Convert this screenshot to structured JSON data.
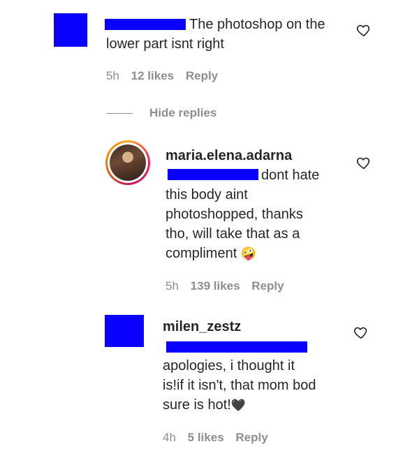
{
  "comment1": {
    "text_line1": "The photoshop on the",
    "text_line2": "lower part isnt right",
    "time": "5h",
    "likes": "12 likes",
    "reply": "Reply",
    "hide_replies": "Hide replies"
  },
  "reply1": {
    "username": "maria.elena.adarna",
    "text_line1": "dont hate",
    "text_line2": "this body aint",
    "text_line3": "photoshopped, thanks",
    "text_line4": "tho, will take that as a",
    "text_line5": "compliment",
    "emoji": "🤪",
    "time": "5h",
    "likes": "139 likes",
    "reply": "Reply"
  },
  "reply2": {
    "username": "milen_zestz",
    "text_line1": "apologies, i thought it",
    "text_line2": "is!if it isn't, that mom bod",
    "text_line3": "sure is hot!",
    "heart_emoji": "🖤",
    "time": "4h",
    "likes": "5 likes",
    "reply": "Reply"
  },
  "colors": {
    "redaction": "#0a00ff",
    "text": "#262626",
    "meta": "#8e8e8e"
  },
  "icons": {
    "like": "heart-outline-icon"
  }
}
